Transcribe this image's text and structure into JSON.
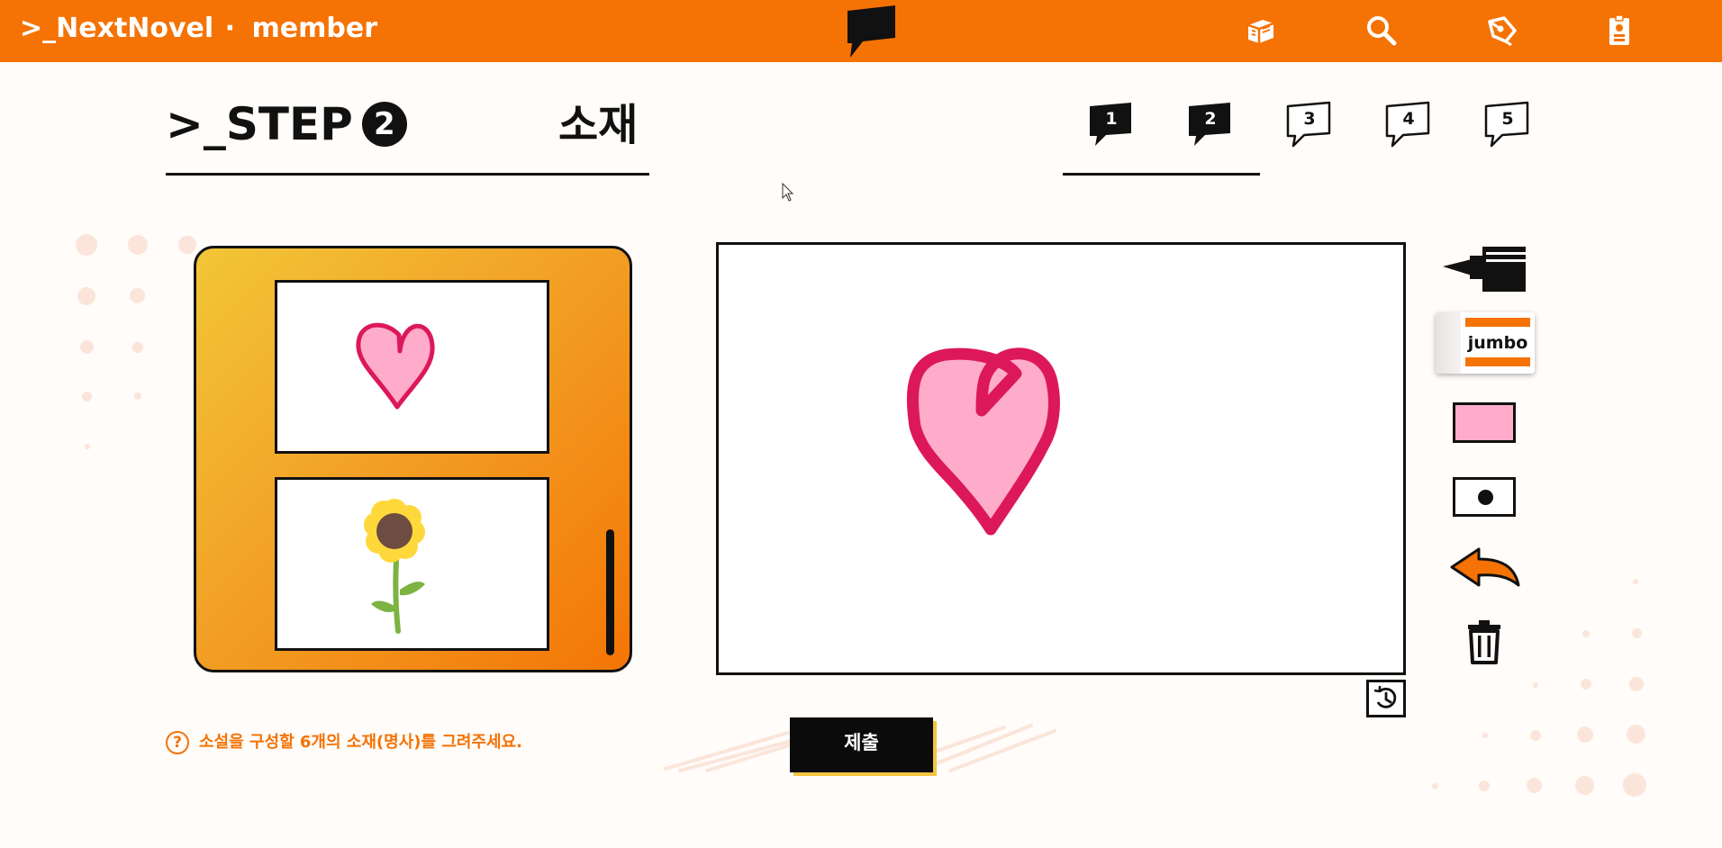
{
  "app": {
    "brand": ">_NextNovel",
    "separator": "·",
    "user_role": "member"
  },
  "nav": {
    "icons": [
      "books-icon",
      "search-icon",
      "pen-icon",
      "id-badge-icon"
    ]
  },
  "step": {
    "title": ">_STEP",
    "number": "2",
    "label": "소재",
    "bubbles": [
      {
        "label": "1",
        "state": "filled"
      },
      {
        "label": "2",
        "state": "filled"
      },
      {
        "label": "3",
        "state": "outline"
      },
      {
        "label": "4",
        "state": "outline"
      },
      {
        "label": "5",
        "state": "outline"
      }
    ]
  },
  "gallery": {
    "thumbnails": [
      "heart",
      "sunflower"
    ]
  },
  "tools": {
    "eraser_label": "jumbo",
    "current_color": "#ffaccb",
    "tool_icons": [
      "pen-tool-icon",
      "eraser-icon",
      "color-swatch",
      "brush-size",
      "undo-icon",
      "trash-icon"
    ]
  },
  "hint": {
    "icon": "?",
    "text": "소설을 구성할 6개의 소재(명사)를 그려주세요."
  },
  "submit": {
    "label": "제출"
  },
  "colors": {
    "brand": "#f57204",
    "heart_fill": "#ffaccb",
    "heart_stroke": "#dc185b",
    "accent_yellow": "#f3c43f"
  }
}
